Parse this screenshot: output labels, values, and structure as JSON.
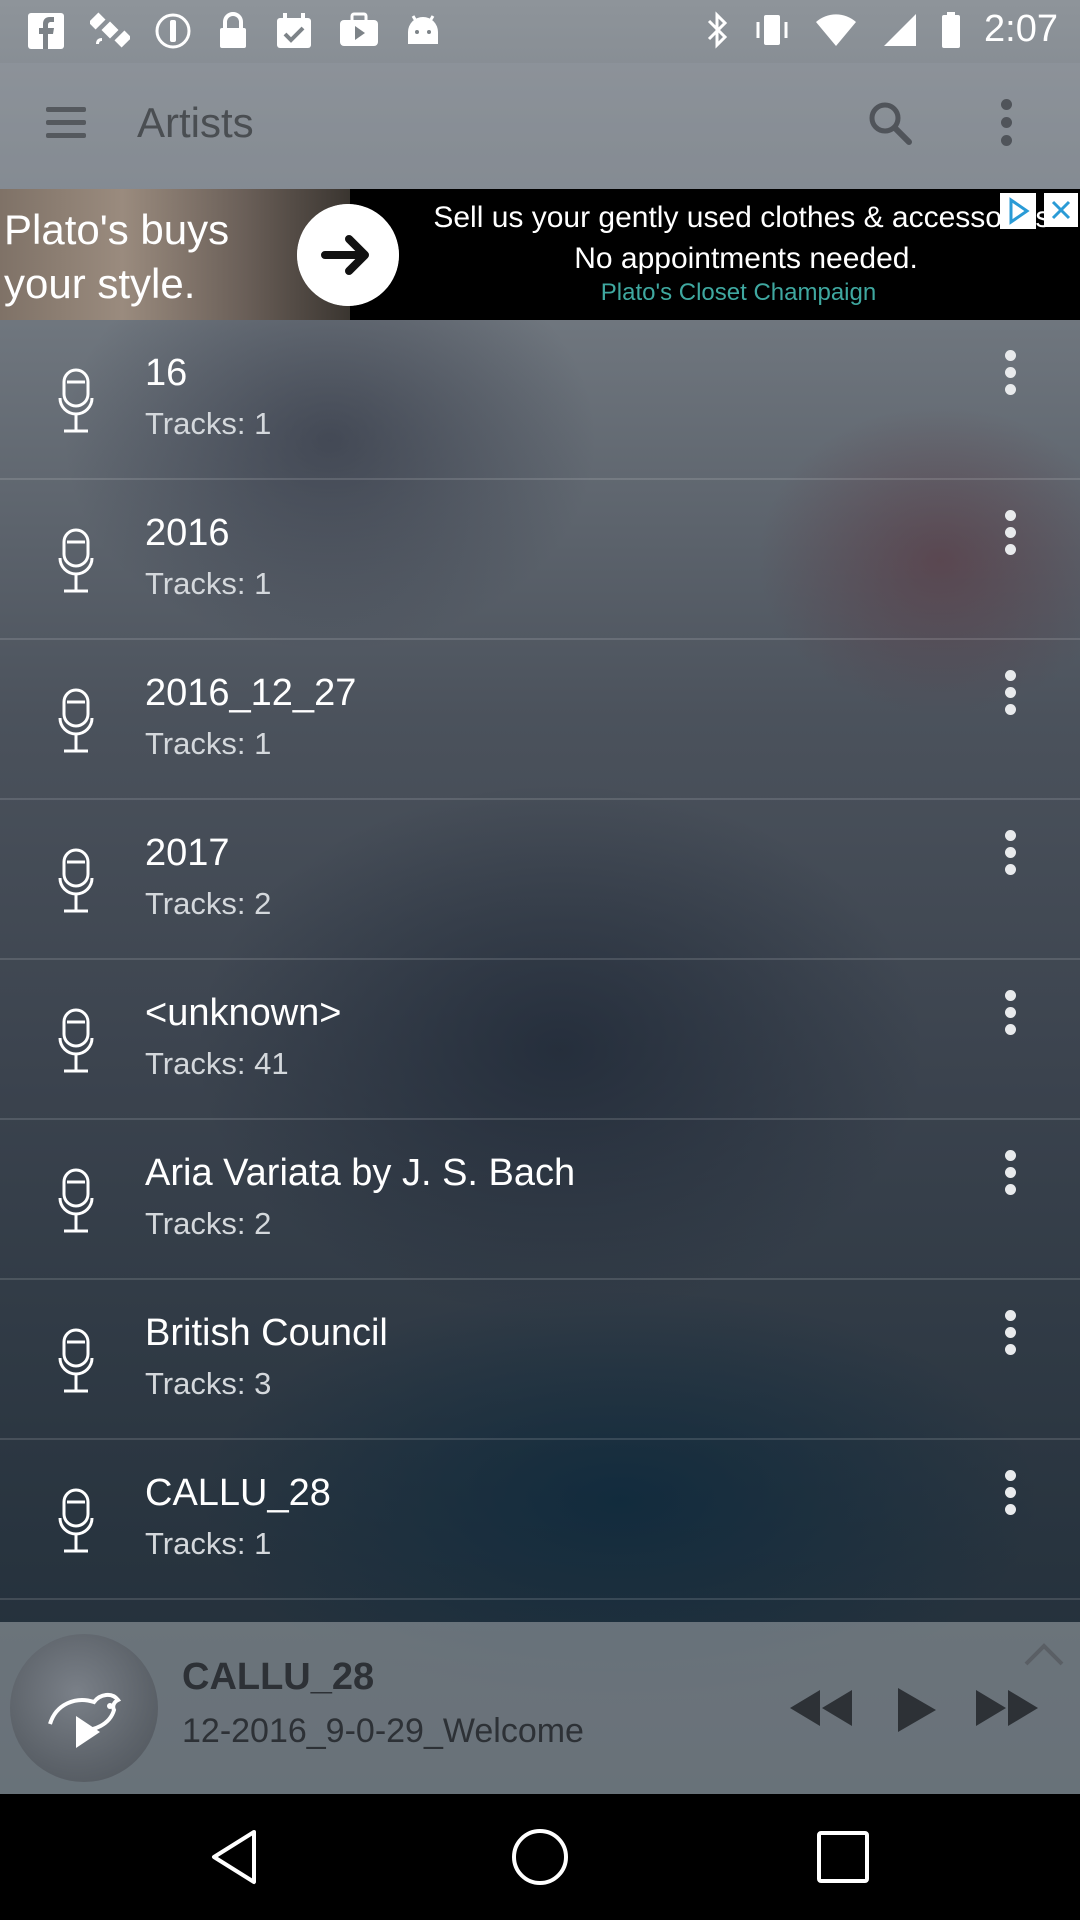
{
  "status_bar": {
    "time": "2:07",
    "left_icons": [
      "facebook-icon",
      "satellite-icon",
      "do-not-disturb-icon",
      "lock-icon",
      "calendar-check-icon",
      "youtube-icon",
      "android-icon"
    ],
    "right_icons": [
      "bluetooth-icon",
      "vibrate-icon",
      "wifi-icon",
      "signal-icon",
      "battery-icon"
    ]
  },
  "toolbar": {
    "title": "Artists"
  },
  "ad": {
    "headline": "Plato's buys your style.",
    "body": "Sell us your gently used clothes & accessories. No appointments needed.",
    "source": "Plato's Closet Champaign"
  },
  "artists": [
    {
      "name": "16",
      "tracks": "Tracks: 1"
    },
    {
      "name": "2016",
      "tracks": "Tracks: 1"
    },
    {
      "name": "2016_12_27",
      "tracks": "Tracks: 1"
    },
    {
      "name": "2017",
      "tracks": "Tracks: 2"
    },
    {
      "name": "<unknown>",
      "tracks": "Tracks: 41"
    },
    {
      "name": "Aria Variata by J. S. Bach",
      "tracks": "Tracks: 2"
    },
    {
      "name": "British Council",
      "tracks": "Tracks: 3"
    },
    {
      "name": "CALLU_28",
      "tracks": "Tracks: 1"
    }
  ],
  "now_playing": {
    "artist": "CALLU_28",
    "track": "12-2016_9-0-29_Welcome"
  },
  "colors": {
    "toolbar_text": "#4a4e52",
    "ad_source": "#3fa8a0",
    "player_text": "#2d3136"
  }
}
